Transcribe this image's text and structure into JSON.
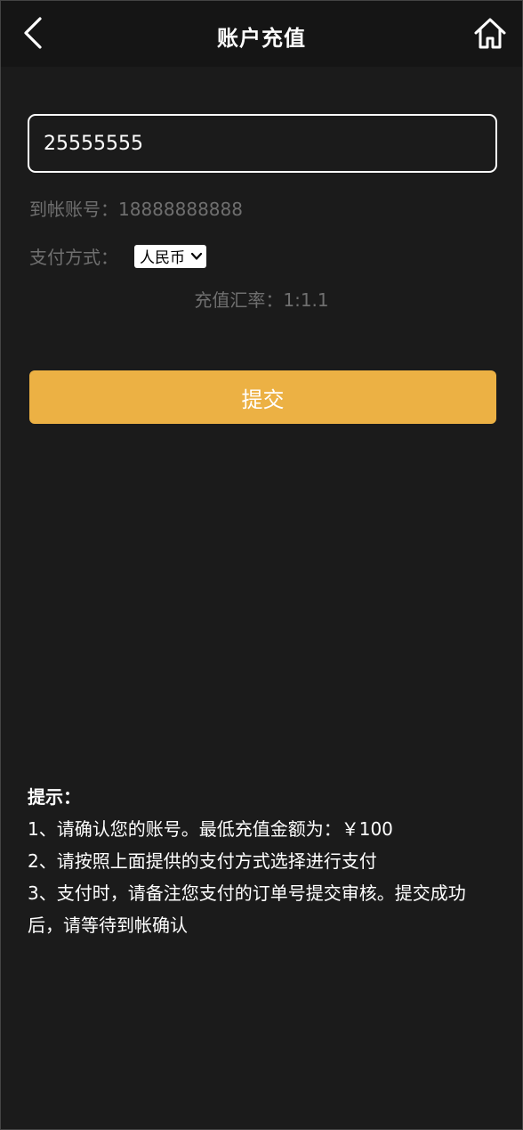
{
  "header": {
    "title": "账户充值"
  },
  "form": {
    "amount_value": "25555555",
    "account_label": "到帐账号：",
    "account_value": "18888888888",
    "payment_label": "支付方式：",
    "payment_selected": "人民币",
    "rate_label": "充值汇率：",
    "rate_value": "1:1.1",
    "submit_label": "提交"
  },
  "tips": {
    "title": "提示：",
    "items": [
      "1、请确认您的账号。最低充值金额为：￥100",
      "2、请按照上面提供的支付方式选择进行支付",
      "3、支付时，请备注您支付的订单号提交审核。提交成功后，请等待到帐确认"
    ]
  },
  "colors": {
    "background": "#1b1b1b",
    "header_bg": "#151515",
    "accent": "#ecb144",
    "muted_text": "#6f6f6f"
  },
  "icons": {
    "back": "chevron-left-icon",
    "home": "home-icon",
    "select": "chevron-down-icon"
  }
}
